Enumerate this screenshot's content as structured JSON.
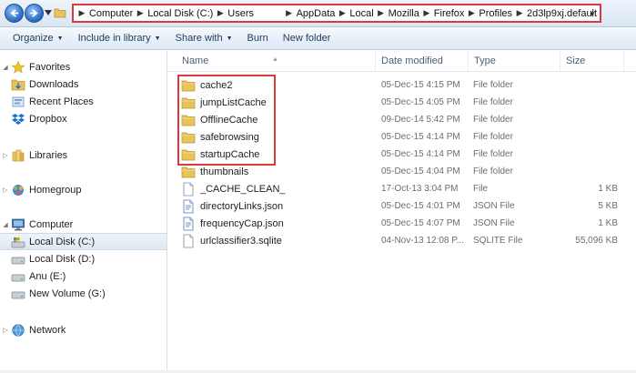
{
  "address_bar": {
    "crumbs": [
      "Computer",
      "Local Disk (C:)",
      "Users",
      "AppData",
      "Local",
      "Mozilla",
      "Firefox",
      "Profiles",
      "2d3lp9xj.default"
    ]
  },
  "toolbar": {
    "organize": "Organize",
    "include_in_library": "Include in library",
    "share_with": "Share with",
    "burn": "Burn",
    "new_folder": "New folder"
  },
  "nav": {
    "favorites": "Favorites",
    "downloads": "Downloads",
    "recent_places": "Recent Places",
    "dropbox": "Dropbox",
    "libraries": "Libraries",
    "homegroup": "Homegroup",
    "computer": "Computer",
    "local_disk_c": "Local Disk (C:)",
    "local_disk_d": "Local Disk (D:)",
    "anu_e": "Anu (E:)",
    "new_volume_g": "New Volume (G:)",
    "network": "Network"
  },
  "columns": {
    "name": "Name",
    "date_modified": "Date modified",
    "type": "Type",
    "size": "Size"
  },
  "files": [
    {
      "name": "cache2",
      "date": "05-Dec-15 4:15 PM",
      "type": "File folder",
      "size": "",
      "icon": "folder-icon"
    },
    {
      "name": "jumpListCache",
      "date": "05-Dec-15 4:05 PM",
      "type": "File folder",
      "size": "",
      "icon": "folder-icon"
    },
    {
      "name": "OfflineCache",
      "date": "09-Dec-14 5:42 PM",
      "type": "File folder",
      "size": "",
      "icon": "folder-icon"
    },
    {
      "name": "safebrowsing",
      "date": "05-Dec-15 4:14 PM",
      "type": "File folder",
      "size": "",
      "icon": "folder-icon"
    },
    {
      "name": "startupCache",
      "date": "05-Dec-15 4:14 PM",
      "type": "File folder",
      "size": "",
      "icon": "folder-icon"
    },
    {
      "name": "thumbnails",
      "date": "05-Dec-15 4:04 PM",
      "type": "File folder",
      "size": "",
      "icon": "folder-icon"
    },
    {
      "name": "_CACHE_CLEAN_",
      "date": "17-Oct-13 3:04 PM",
      "type": "File",
      "size": "1 KB",
      "icon": "file-icon"
    },
    {
      "name": "directoryLinks.json",
      "date": "05-Dec-15 4:01 PM",
      "type": "JSON File",
      "size": "5 KB",
      "icon": "json-file-icon"
    },
    {
      "name": "frequencyCap.json",
      "date": "05-Dec-15 4:07 PM",
      "type": "JSON File",
      "size": "1 KB",
      "icon": "json-file-icon"
    },
    {
      "name": "urlclassifier3.sqlite",
      "date": "04-Nov-13 12:08 P...",
      "type": "SQLITE File",
      "size": "55,096 KB",
      "icon": "file-icon"
    }
  ],
  "colors": {
    "highlight": "#d93b3b",
    "folder": "#e8c35a",
    "toolbar_text": "#1e395b"
  }
}
